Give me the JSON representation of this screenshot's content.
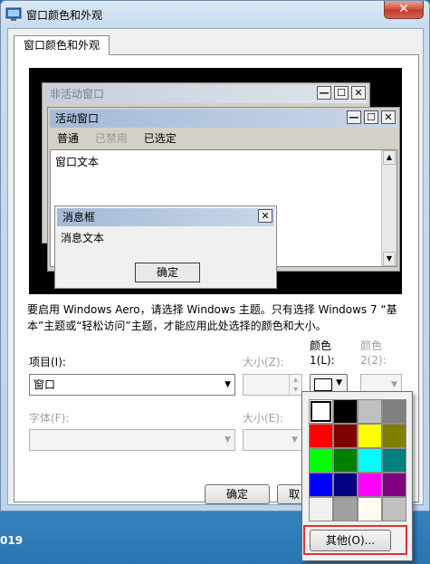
{
  "window": {
    "title": "窗口颜色和外观",
    "close_glyph": "✕"
  },
  "tab": {
    "label": "窗口颜色和外观"
  },
  "preview": {
    "inactive_title": "非活动窗口",
    "active_title": "活动窗口",
    "menu": [
      "普通",
      "已禁用",
      "已选定"
    ],
    "window_text": "窗口文本",
    "message_title": "消息框",
    "message_text": "消息文本",
    "message_ok": "确定",
    "min_glyph": "—",
    "max_glyph": "☐",
    "close_glyph": "✕"
  },
  "aero_note": "要启用 Windows Aero，请选择 Windows 主题。只有选择 Windows 7 “基本”主题或“轻松访问”主题，才能应用此处选择的颜色和大小。",
  "fields": {
    "item_label": "项目(I):",
    "item_value": "窗口",
    "size_label": "大小(Z):",
    "color1_label_a": "颜色",
    "color1_label_b": "1(L):",
    "color2_label_a": "颜色",
    "color2_label_b": "2(2):",
    "font_label": "字体(F):",
    "font_size_label": "大小(E):",
    "color1_value": "#ffffff"
  },
  "buttons": {
    "ok": "确定",
    "cancel_partial": "取"
  },
  "palette": {
    "colors": [
      "#ffffff",
      "#000000",
      "#c0c0c0",
      "#808080",
      "#ff0000",
      "#800000",
      "#ffff00",
      "#808000",
      "#00ff00",
      "#008000",
      "#00ffff",
      "#008080",
      "#0000ff",
      "#000080",
      "#ff00ff",
      "#800080",
      "#f0f0f0",
      "#a0a0a0",
      "#fffbf0",
      "#c0c0c0"
    ],
    "selected_index": 0,
    "other_label": "其他(O)..."
  },
  "taskbar": {
    "partial_text": "019"
  }
}
